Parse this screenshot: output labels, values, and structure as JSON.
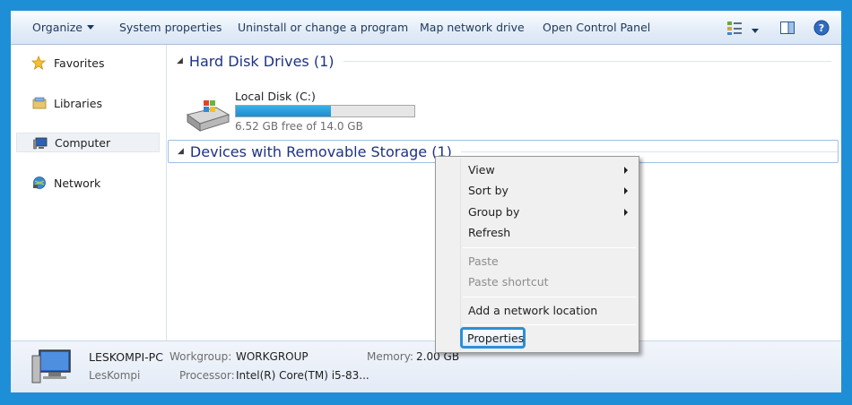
{
  "toolbar": {
    "organize": "Organize",
    "system_properties": "System properties",
    "uninstall": "Uninstall or change a program",
    "map_network_drive": "Map network drive",
    "open_control_panel": "Open Control Panel",
    "icons": [
      "view-options-icon",
      "chevron-down-icon",
      "preview-pane-icon",
      "help-icon"
    ]
  },
  "nav": {
    "items": [
      {
        "label": "Favorites",
        "icon": "star-icon"
      },
      {
        "label": "Libraries",
        "icon": "libraries-icon"
      },
      {
        "label": "Computer",
        "icon": "computer-icon",
        "selected": true
      },
      {
        "label": "Network",
        "icon": "network-icon"
      }
    ]
  },
  "groups": {
    "hard_disks": "Hard Disk Drives (1)",
    "removable": "Devices with Removable Storage (1)"
  },
  "drive": {
    "name": "Local Disk (C:)",
    "free_text": "6.52 GB free of 14.0 GB",
    "used_fraction": 0.534
  },
  "details": {
    "pc_name": "LESKOMPI-PC",
    "user": "LesKompi",
    "workgroup_key": "Workgroup:",
    "workgroup_val": "WORKGROUP",
    "memory_key": "Memory:",
    "memory_val": "2.00 GB",
    "processor_key": "Processor:",
    "processor_val": "Intel(R) Core(TM) i5-83..."
  },
  "context_menu": {
    "view": "View",
    "sort_by": "Sort by",
    "group_by": "Group by",
    "refresh": "Refresh",
    "paste": "Paste",
    "paste_shortcut": "Paste shortcut",
    "add_network_location": "Add a network location",
    "properties": "Properties"
  },
  "colors": {
    "frame": "#1e8fd6",
    "group_header": "#1e3287",
    "drive_bar": "#26a0da",
    "highlight_border": "#2b8fd8"
  }
}
